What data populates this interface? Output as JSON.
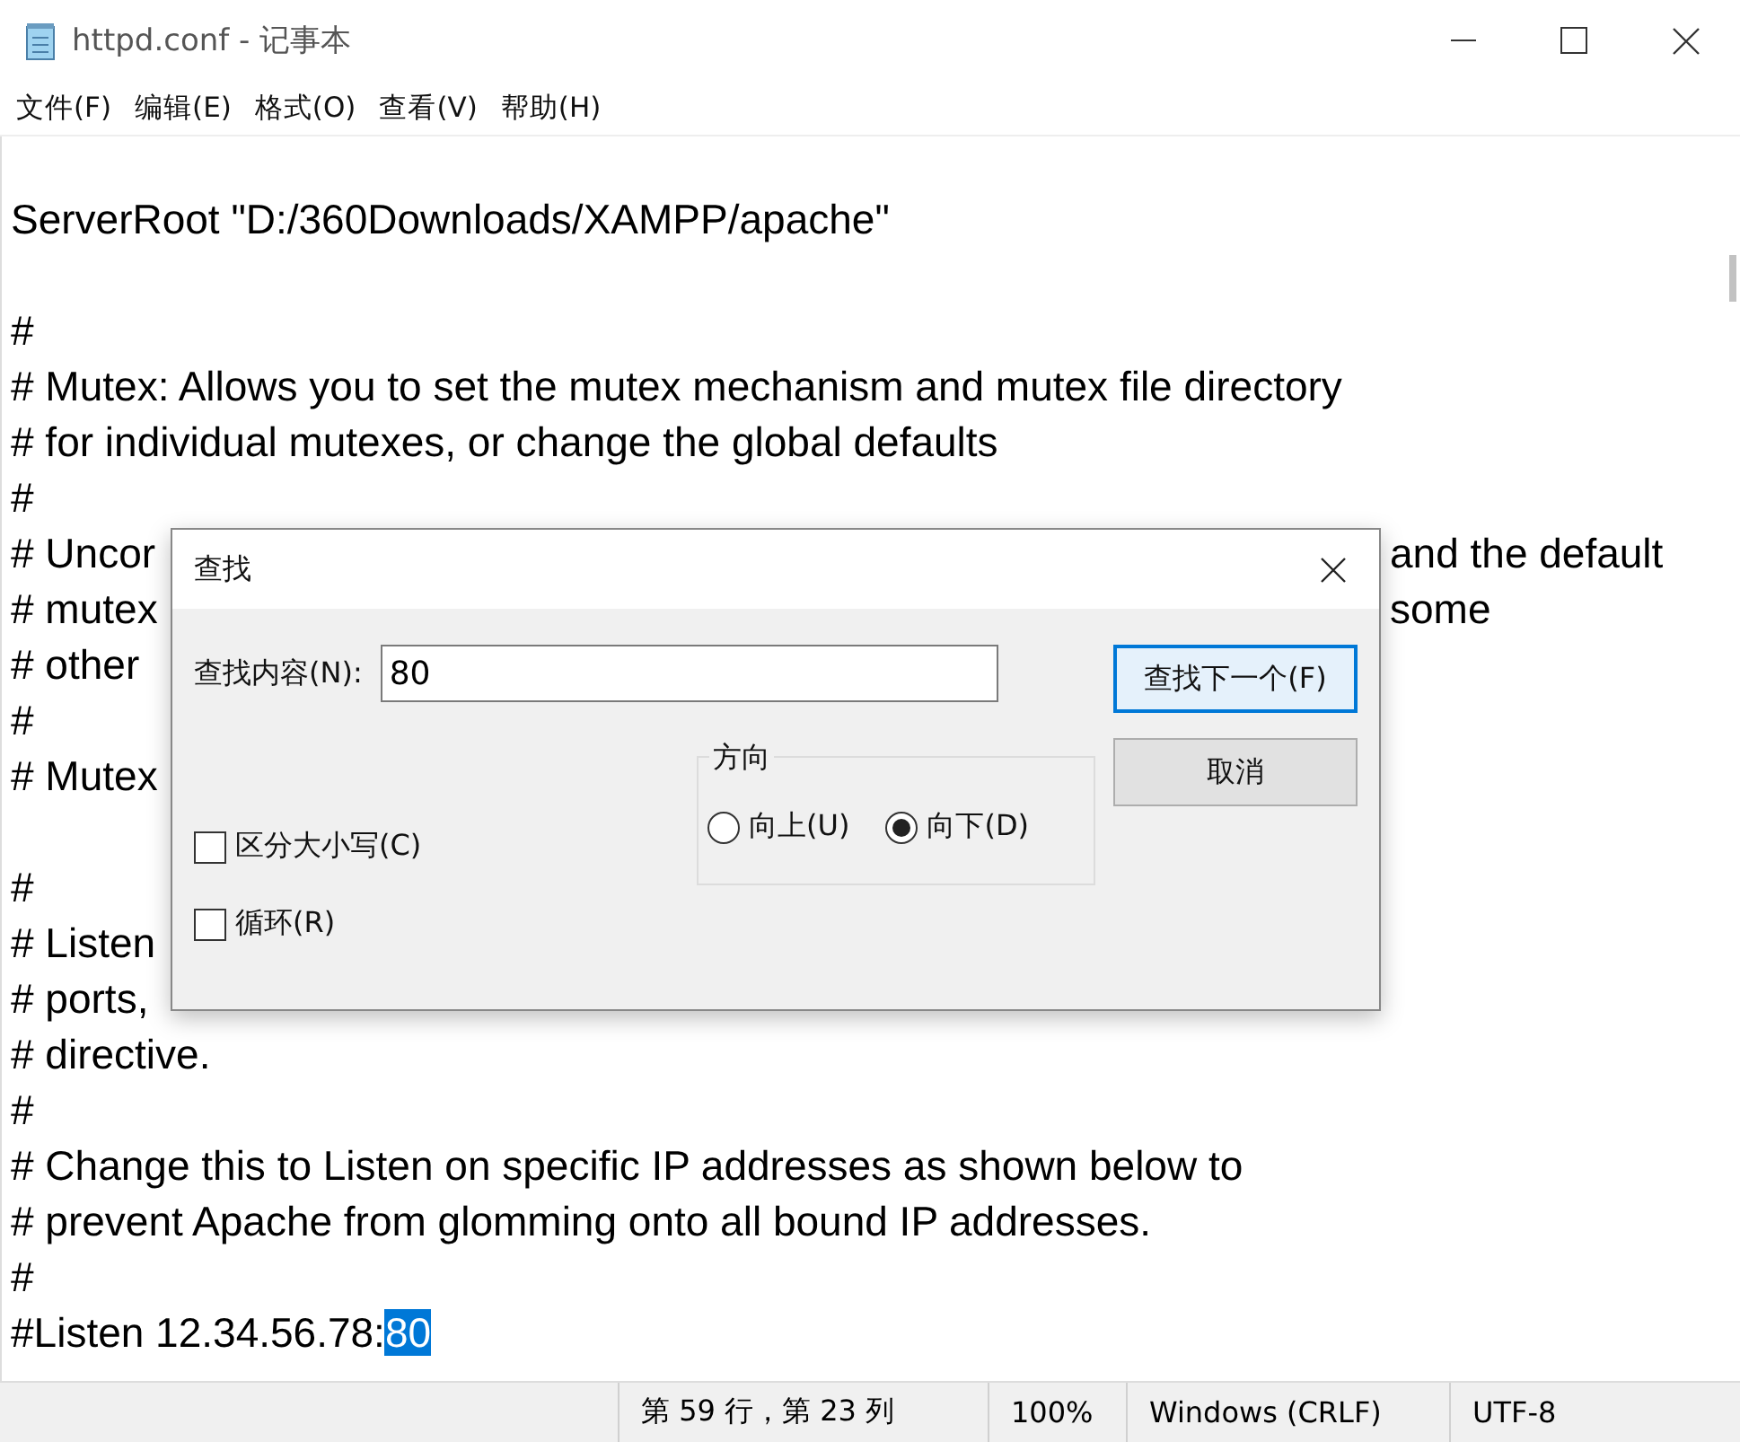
{
  "window": {
    "title": "httpd.conf - 记事本"
  },
  "menu": [
    "文件(F)",
    "编辑(E)",
    "格式(O)",
    "查看(V)",
    "帮助(H)"
  ],
  "editor": {
    "paragraphs": [
      [
        {
          "text": "ServerRoot \"D:/360Downloads/XAMPP/apache\""
        }
      ],
      [
        {
          "text": "#"
        },
        {
          "text": "# Mutex: Allows you to set the mutex mechanism and mutex file directory"
        },
        {
          "text": "# for individual mutexes, or change the global defaults"
        },
        {
          "text": "#"
        },
        {
          "text": "# Uncor",
          "right": "and the default"
        },
        {
          "text": "# mutex",
          "right": "some"
        },
        {
          "text": "# other"
        },
        {
          "text": "#"
        },
        {
          "text": "# Mutex"
        }
      ],
      [
        {
          "text": "#"
        },
        {
          "text": "# Listen"
        },
        {
          "text": "# ports,"
        },
        {
          "text": "# directive."
        },
        {
          "text": "#"
        },
        {
          "text": "# Change this to Listen on specific IP addresses as shown below to"
        },
        {
          "text": "# prevent Apache from glomming onto all bound IP addresses."
        },
        {
          "text": "#"
        },
        {
          "text": "#Listen 12.34.56.78:",
          "selected_text": "80"
        }
      ]
    ]
  },
  "find_dialog": {
    "title": "查找",
    "find_label": "查找内容(N):",
    "find_value": "80",
    "buttons": [
      {
        "label": "查找下一个(F)",
        "default": true
      },
      {
        "label": "取消",
        "default": false
      }
    ],
    "direction": {
      "label": "方向",
      "options": [
        {
          "label": "向上(U)",
          "selected": false
        },
        {
          "label": "向下(D)",
          "selected": true
        }
      ]
    },
    "checkboxes": [
      {
        "label": "区分大小写(C)",
        "checked": false
      },
      {
        "label": "循环(R)",
        "checked": false
      }
    ]
  },
  "status_bar": [
    "第 59 行，第 23 列",
    "100%",
    "Windows (CRLF)",
    "UTF-8"
  ]
}
